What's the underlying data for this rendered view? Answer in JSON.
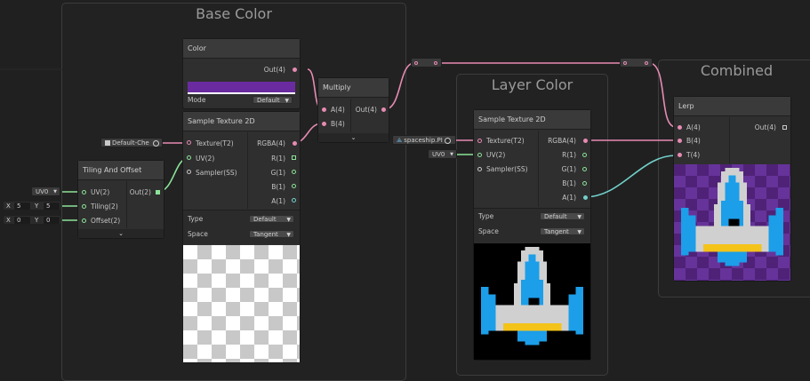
{
  "groups": {
    "base_color": "Base Color",
    "layer_color": "Layer Color",
    "combined": "Combined"
  },
  "color_node": {
    "title": "Color",
    "output": "Out(4)",
    "swatch": "#6a2ba0",
    "mode_label": "Mode",
    "mode_value": "Default"
  },
  "multiply_node": {
    "title": "Multiply",
    "input_a": "A(4)",
    "input_b": "B(4)",
    "output": "Out(4)"
  },
  "sample_texture_base": {
    "title": "Sample Texture 2D",
    "inputs": [
      "Texture(T2)",
      "UV(2)",
      "Sampler(SS)"
    ],
    "outputs": [
      "RGBA(4)",
      "R(1)",
      "G(1)",
      "B(1)",
      "A(1)"
    ],
    "type_label": "Type",
    "type_value": "Default",
    "space_label": "Space",
    "space_value": "Tangent",
    "texture_ref": "Default-Che"
  },
  "tiling_node": {
    "title": "Tiling And Offset",
    "inputs": [
      "UV(2)",
      "Tiling(2)",
      "Offset(2)"
    ],
    "output": "Out(2)",
    "uv_value": "UV0",
    "tiling_x": "5",
    "tiling_y": "5",
    "offset_x": "0",
    "offset_y": "0",
    "x_label": "X",
    "y_label": "Y"
  },
  "sample_texture_layer": {
    "title": "Sample Texture 2D",
    "inputs": [
      "Texture(T2)",
      "UV(2)",
      "Sampler(SS)"
    ],
    "outputs": [
      "RGBA(4)",
      "R(1)",
      "G(1)",
      "B(1)",
      "A(1)"
    ],
    "type_label": "Type",
    "type_value": "Default",
    "space_label": "Space",
    "space_value": "Tangent",
    "texture_ref": "spaceship.PI",
    "uv_value": "UV0"
  },
  "lerp_node": {
    "title": "Lerp",
    "inputs": [
      "A(4)",
      "B(4)",
      "T(4)"
    ],
    "output": "Out(4)"
  },
  "colors": {
    "wire_pink": "#e78bb3",
    "wire_green": "#8ce398",
    "wire_teal": "#72d0c9",
    "ship_blue": "#1c9ee8",
    "ship_yellow": "#f4c31a",
    "ship_grey": "#d0d0d0"
  }
}
